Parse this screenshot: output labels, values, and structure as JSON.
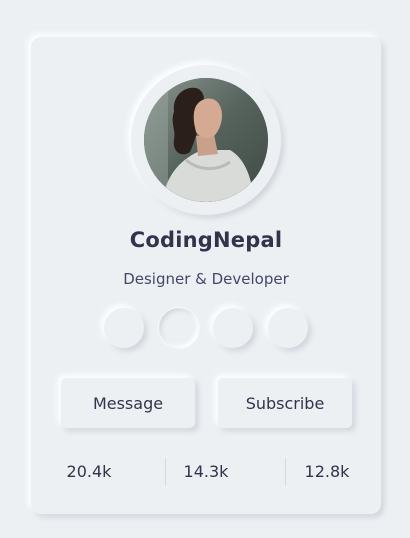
{
  "profile": {
    "name": "CodingNepal",
    "title": "Designer & Developer"
  },
  "social_links": [
    {
      "name": "social-link-1"
    },
    {
      "name": "social-link-2"
    },
    {
      "name": "social-link-3"
    },
    {
      "name": "social-link-4"
    }
  ],
  "buttons": {
    "message": "Message",
    "subscribe": "Subscribe"
  },
  "stats": [
    "20.4k",
    "14.3k",
    "12.8k"
  ],
  "colors": {
    "background": "#ecf0f3",
    "text": "#31344b",
    "shadow_dark": "#cdd3da",
    "shadow_light": "#ffffff"
  }
}
